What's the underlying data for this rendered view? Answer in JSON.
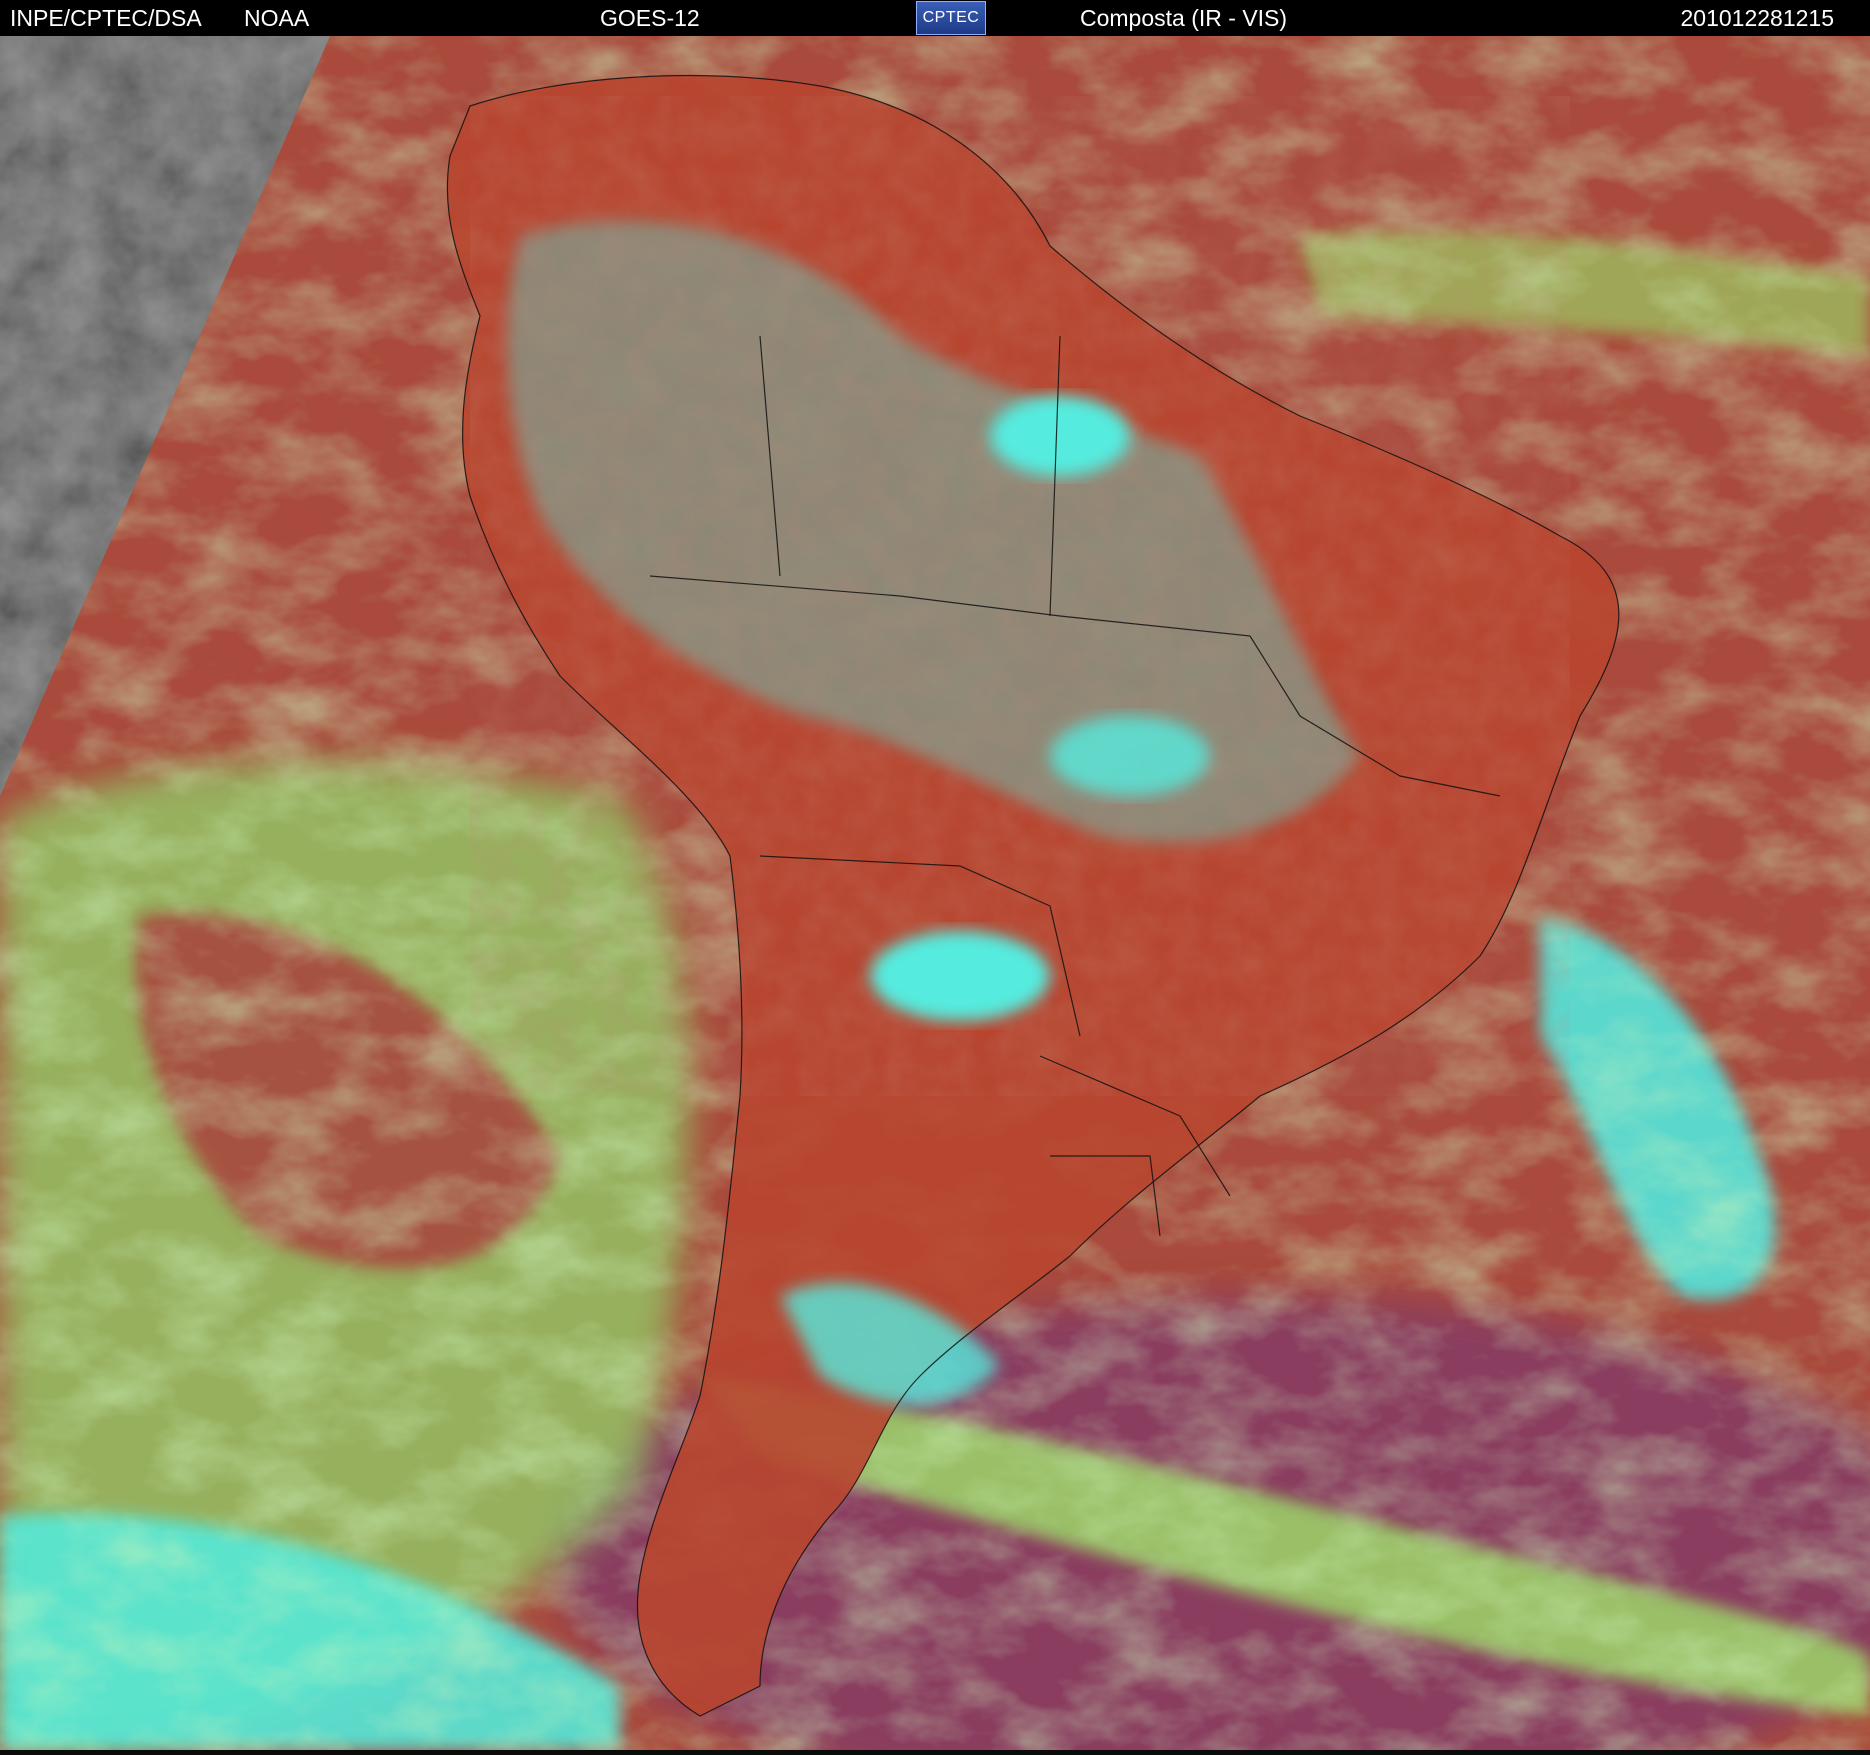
{
  "header": {
    "organization": "INPE/CPTEC/DSA",
    "agency": "NOAA",
    "satellite": "GOES-12",
    "logo_text": "CPTEC",
    "product": "Composta (IR - VIS)",
    "timestamp": "201012281215"
  },
  "colors": {
    "header_bg": "#000000",
    "header_text": "#ffffff",
    "land_clear": "#b8452f",
    "ocean_clear": "#a94a3c",
    "south_ocean": "#8a3e5e",
    "high_cloud": "#4ff0e6",
    "low_cloud": "#9be36a",
    "night_side": "#3a3a3a"
  }
}
